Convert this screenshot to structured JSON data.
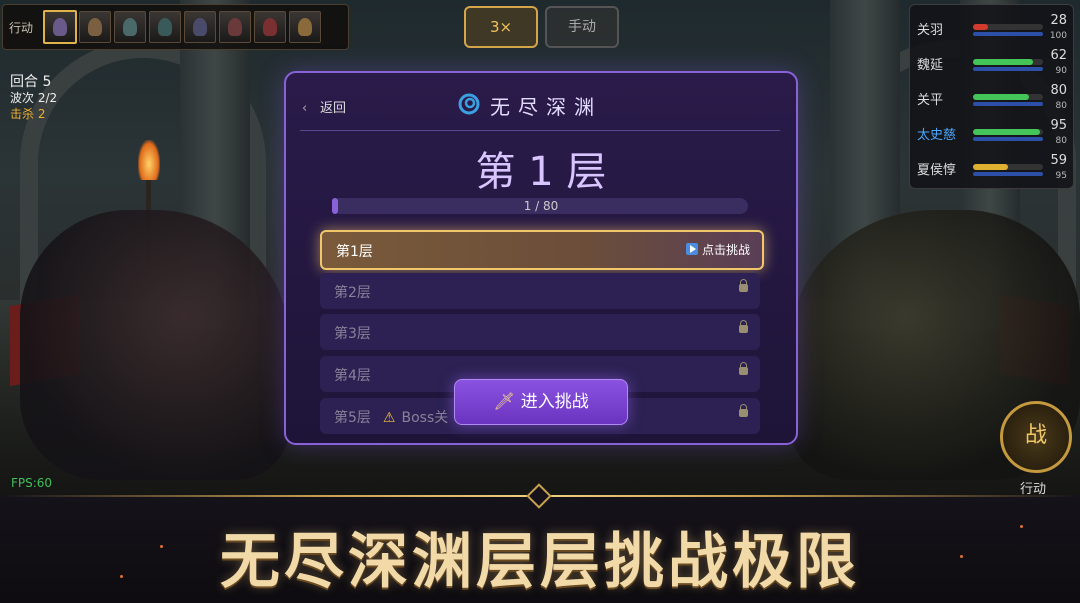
{
  "action_bar": {
    "label": "行动"
  },
  "speed_button": {
    "label": "3×"
  },
  "manual_button": {
    "label": "手动"
  },
  "battle_stats": {
    "round": "回合 5",
    "wave": "波次 2/2",
    "kills": "击杀 2"
  },
  "heroes": [
    {
      "name": "关羽",
      "hp": 28,
      "mp": 100,
      "color": "#d33b2f",
      "hp_fraction": 0.22,
      "name_color": "#dddddd"
    },
    {
      "name": "魏延",
      "hp": 62,
      "mp": 90,
      "color": "#43c55a",
      "hp_fraction": 0.85,
      "name_color": "#dddddd"
    },
    {
      "name": "关平",
      "hp": 80,
      "mp": 80,
      "color": "#43c55a",
      "hp_fraction": 0.8,
      "name_color": "#dddddd"
    },
    {
      "name": "太史慈",
      "hp": 95,
      "mp": 80,
      "color": "#43c55a",
      "hp_fraction": 0.95,
      "name_color": "#4aa8ff"
    },
    {
      "name": "夏侯惇",
      "hp": 59,
      "mp": 95,
      "color": "#e0b030",
      "hp_fraction": 0.5,
      "name_color": "#dddddd"
    }
  ],
  "fps": "FPS:60",
  "fight_button": {
    "label": "战",
    "caption": "行动"
  },
  "modal": {
    "back_label": "返回",
    "title": "无尽深渊",
    "current_floor": "第 1 层",
    "progress_text": "1 / 80",
    "progress_fraction": 0.0125,
    "floors": [
      {
        "label": "第1层",
        "state": "active",
        "cta": "点击挑战"
      },
      {
        "label": "第2层",
        "state": "locked"
      },
      {
        "label": "第3层",
        "state": "locked"
      },
      {
        "label": "第4层",
        "state": "locked"
      },
      {
        "label": "第5层",
        "state": "locked",
        "boss": "Boss关"
      }
    ],
    "enter_button": "进入挑战"
  },
  "banner": {
    "slogan": "无尽深渊层层挑战极限"
  },
  "colors": {
    "accent_gold": "#f1c76b",
    "modal_border": "#8a62d8",
    "enter_button": "#7a44d0"
  }
}
